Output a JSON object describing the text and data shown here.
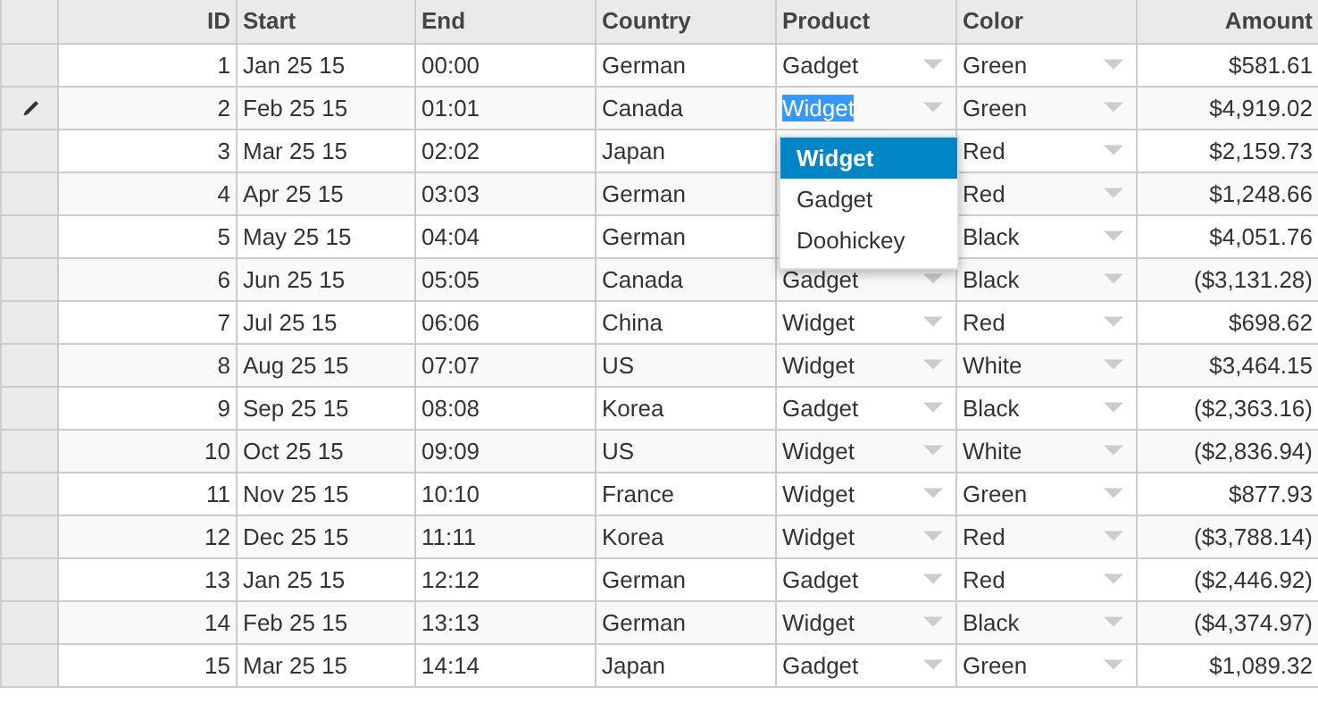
{
  "columns": [
    {
      "label": "ID"
    },
    {
      "label": "Start"
    },
    {
      "label": "End"
    },
    {
      "label": "Country"
    },
    {
      "label": "Product"
    },
    {
      "label": "Color"
    },
    {
      "label": "Amount"
    }
  ],
  "rows": [
    {
      "id": "1",
      "start": "Jan 25 15",
      "end": "00:00",
      "country": "German",
      "product": "Gadget",
      "color_choice": "Green",
      "amount": "$581.61",
      "editing": false
    },
    {
      "id": "2",
      "start": "Feb 25 15",
      "end": "01:01",
      "country": "Canada",
      "product": "Widget",
      "color_choice": "Green",
      "amount": "$4,919.02",
      "editing": true
    },
    {
      "id": "3",
      "start": "Mar 25 15",
      "end": "02:02",
      "country": "Japan",
      "color_choice": "Red",
      "amount": "$2,159.73",
      "editing": false
    },
    {
      "id": "4",
      "start": "Apr 25 15",
      "end": "03:03",
      "country": "German",
      "color_choice": "Red",
      "amount": "$1,248.66",
      "editing": false
    },
    {
      "id": "5",
      "start": "May 25 15",
      "end": "04:04",
      "country": "German",
      "color_choice": "Black",
      "amount": "$4,051.76",
      "editing": false
    },
    {
      "id": "6",
      "start": "Jun 25 15",
      "end": "05:05",
      "country": "Canada",
      "product": "Gadget",
      "color_choice": "Black",
      "amount": "($3,131.28)",
      "editing": false
    },
    {
      "id": "7",
      "start": "Jul 25 15",
      "end": "06:06",
      "country": "China",
      "product": "Widget",
      "color_choice": "Red",
      "amount": "$698.62",
      "editing": false
    },
    {
      "id": "8",
      "start": "Aug 25 15",
      "end": "07:07",
      "country": "US",
      "product": "Widget",
      "color_choice": "White",
      "amount": "$3,464.15",
      "editing": false
    },
    {
      "id": "9",
      "start": "Sep 25 15",
      "end": "08:08",
      "country": "Korea",
      "product": "Gadget",
      "color_choice": "Black",
      "amount": "($2,363.16)",
      "editing": false
    },
    {
      "id": "10",
      "start": "Oct 25 15",
      "end": "09:09",
      "country": "US",
      "product": "Widget",
      "color_choice": "White",
      "amount": "($2,836.94)",
      "editing": false
    },
    {
      "id": "11",
      "start": "Nov 25 15",
      "end": "10:10",
      "country": "France",
      "product": "Widget",
      "color_choice": "Green",
      "amount": "$877.93",
      "editing": false
    },
    {
      "id": "12",
      "start": "Dec 25 15",
      "end": "11:11",
      "country": "Korea",
      "product": "Widget",
      "color_choice": "Red",
      "amount": "($3,788.14)",
      "editing": false
    },
    {
      "id": "13",
      "start": "Jan 25 15",
      "end": "12:12",
      "country": "German",
      "product": "Gadget",
      "color_choice": "Red",
      "amount": "($2,446.92)",
      "editing": false
    },
    {
      "id": "14",
      "start": "Feb 25 15",
      "end": "13:13",
      "country": "German",
      "product": "Widget",
      "color_choice": "Black",
      "amount": "($4,374.97)",
      "editing": false
    },
    {
      "id": "15",
      "start": "Mar 25 15",
      "end": "14:14",
      "country": "Japan",
      "product": "Gadget",
      "color_choice": "Green",
      "amount": "$1,089.32",
      "editing": false
    }
  ],
  "dropdown": {
    "items": [
      {
        "label": "Widget",
        "selected": true
      },
      {
        "label": "Gadget",
        "selected": false
      },
      {
        "label": "Doohickey",
        "selected": false
      }
    ]
  }
}
